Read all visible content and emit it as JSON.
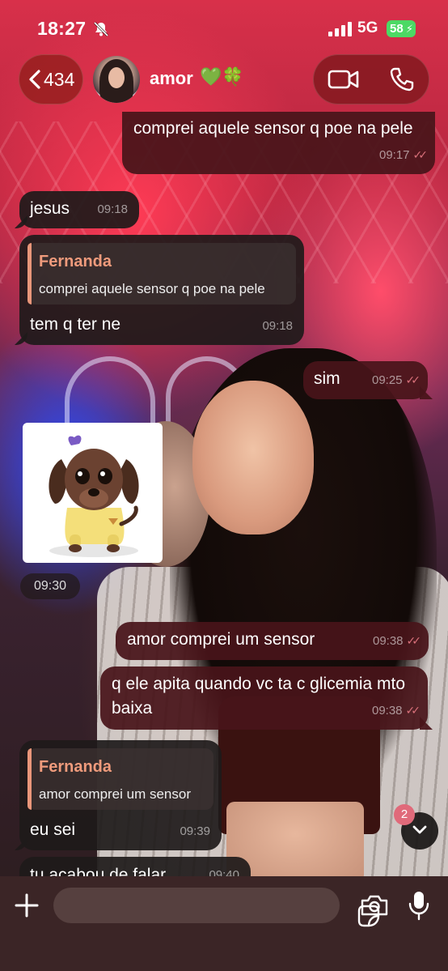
{
  "status_bar": {
    "time": "18:27",
    "network": "5G",
    "battery": "58"
  },
  "header": {
    "back_count": "434",
    "contact_name": "amor",
    "contact_emoji": "💚🍀"
  },
  "messages": [
    {
      "text": "comprei aquele sensor q poe na pele",
      "time": "09:17",
      "ticks": "✓✓"
    },
    {
      "text": "jesus",
      "time": "09:18"
    },
    {
      "reply_name": "Fernanda",
      "reply_text": "comprei aquele sensor q poe na pele",
      "text": "tem q ter ne",
      "time": "09:18"
    },
    {
      "text": "sim",
      "time": "09:25",
      "ticks": "✓✓"
    },
    {
      "sticker": "puppy-sticker",
      "time": "09:30"
    },
    {
      "text": "amor comprei um sensor",
      "time": "09:38",
      "ticks": "✓✓"
    },
    {
      "text": "q ele apita quando vc ta c glicemia mto baixa",
      "time": "09:38",
      "ticks": "✓✓"
    },
    {
      "reply_name": "Fernanda",
      "reply_text": "amor comprei um sensor",
      "text": "eu sei",
      "time": "09:39"
    },
    {
      "text": "tu acabou de falar",
      "time": "09:40"
    }
  ],
  "scroll": {
    "unread": "2"
  },
  "input": {
    "placeholder": ""
  },
  "icons": [
    "bell-slash-icon",
    "signal-icon",
    "battery-icon",
    "chevron-left-icon",
    "video-icon",
    "phone-icon",
    "chevron-down-icon",
    "plus-icon",
    "sticker-icon",
    "camera-icon",
    "mic-icon"
  ],
  "colors": {
    "outgoing_bubble": "#48141a",
    "incoming_bubble": "#1e1a1a",
    "reply_accent": "#ef9b7c",
    "read_ticks": "#d9707a",
    "battery": "#4cd964"
  }
}
